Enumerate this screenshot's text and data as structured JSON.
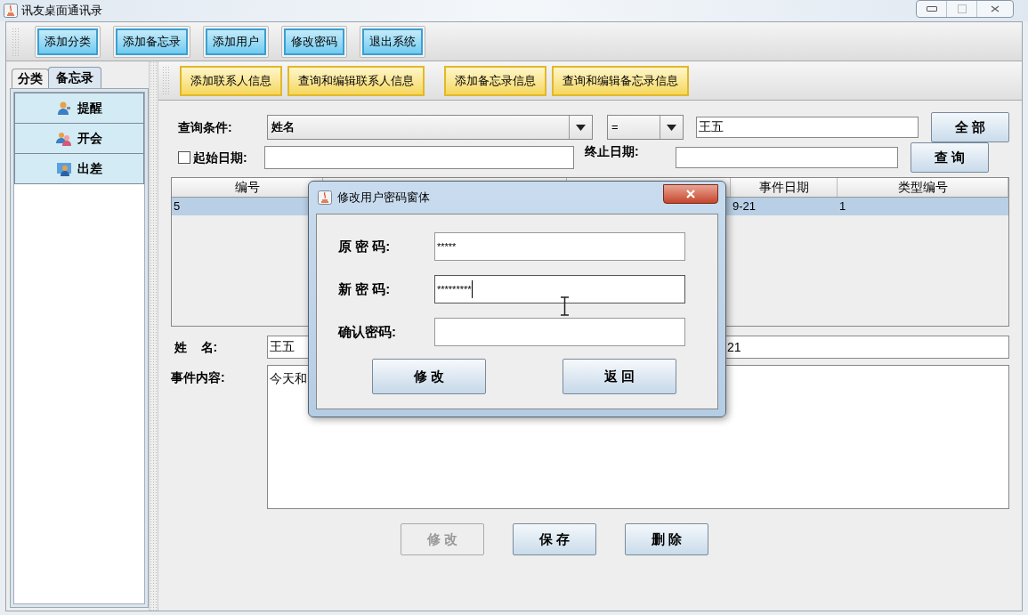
{
  "window": {
    "title": "讯友桌面通讯录"
  },
  "toolbar": [
    "添加分类",
    "添加备忘录",
    "添加用户",
    "修改密码",
    "退出系统"
  ],
  "side_tabs": [
    {
      "label": "分类",
      "selected": false
    },
    {
      "label": "备忘录",
      "selected": true
    }
  ],
  "side_items": [
    {
      "label": "提醒"
    },
    {
      "label": "开会"
    },
    {
      "label": "出差"
    }
  ],
  "sub_toolbar": [
    "添加联系人信息",
    "查询和编辑联系人信息",
    "添加备忘录信息",
    "查询和编辑备忘录信息"
  ],
  "query": {
    "label": "查询条件:",
    "field": "姓名",
    "operator": "=",
    "value": "王五",
    "start_label": "起始日期:",
    "start_checked": false,
    "end_label": "终止日期:",
    "buttons": [
      "全 部",
      "查 询"
    ]
  },
  "table": {
    "columns": [
      "编号",
      "事件日期",
      "类型编号"
    ],
    "rows": [
      {
        "cells": [
          "5",
          "9-21",
          "1"
        ],
        "selected": true
      }
    ]
  },
  "form": {
    "name_label": "姓    名:",
    "name": "王五",
    "date": "21",
    "content_label": "事件内容:",
    "content": "今天和",
    "buttons": [
      {
        "label": "修 改",
        "disabled": true
      },
      {
        "label": "保 存",
        "disabled": false
      },
      {
        "label": "删 除",
        "disabled": false
      }
    ]
  },
  "dialog": {
    "title": "修改用户密码窗体",
    "fields": [
      {
        "label": "原 密 码:",
        "value": "*****",
        "focused": false
      },
      {
        "label": "新 密 码:",
        "value": "*********",
        "focused": true
      },
      {
        "label": "确认密码:",
        "focused": false
      }
    ],
    "buttons": [
      "修 改",
      "返 回"
    ]
  }
}
